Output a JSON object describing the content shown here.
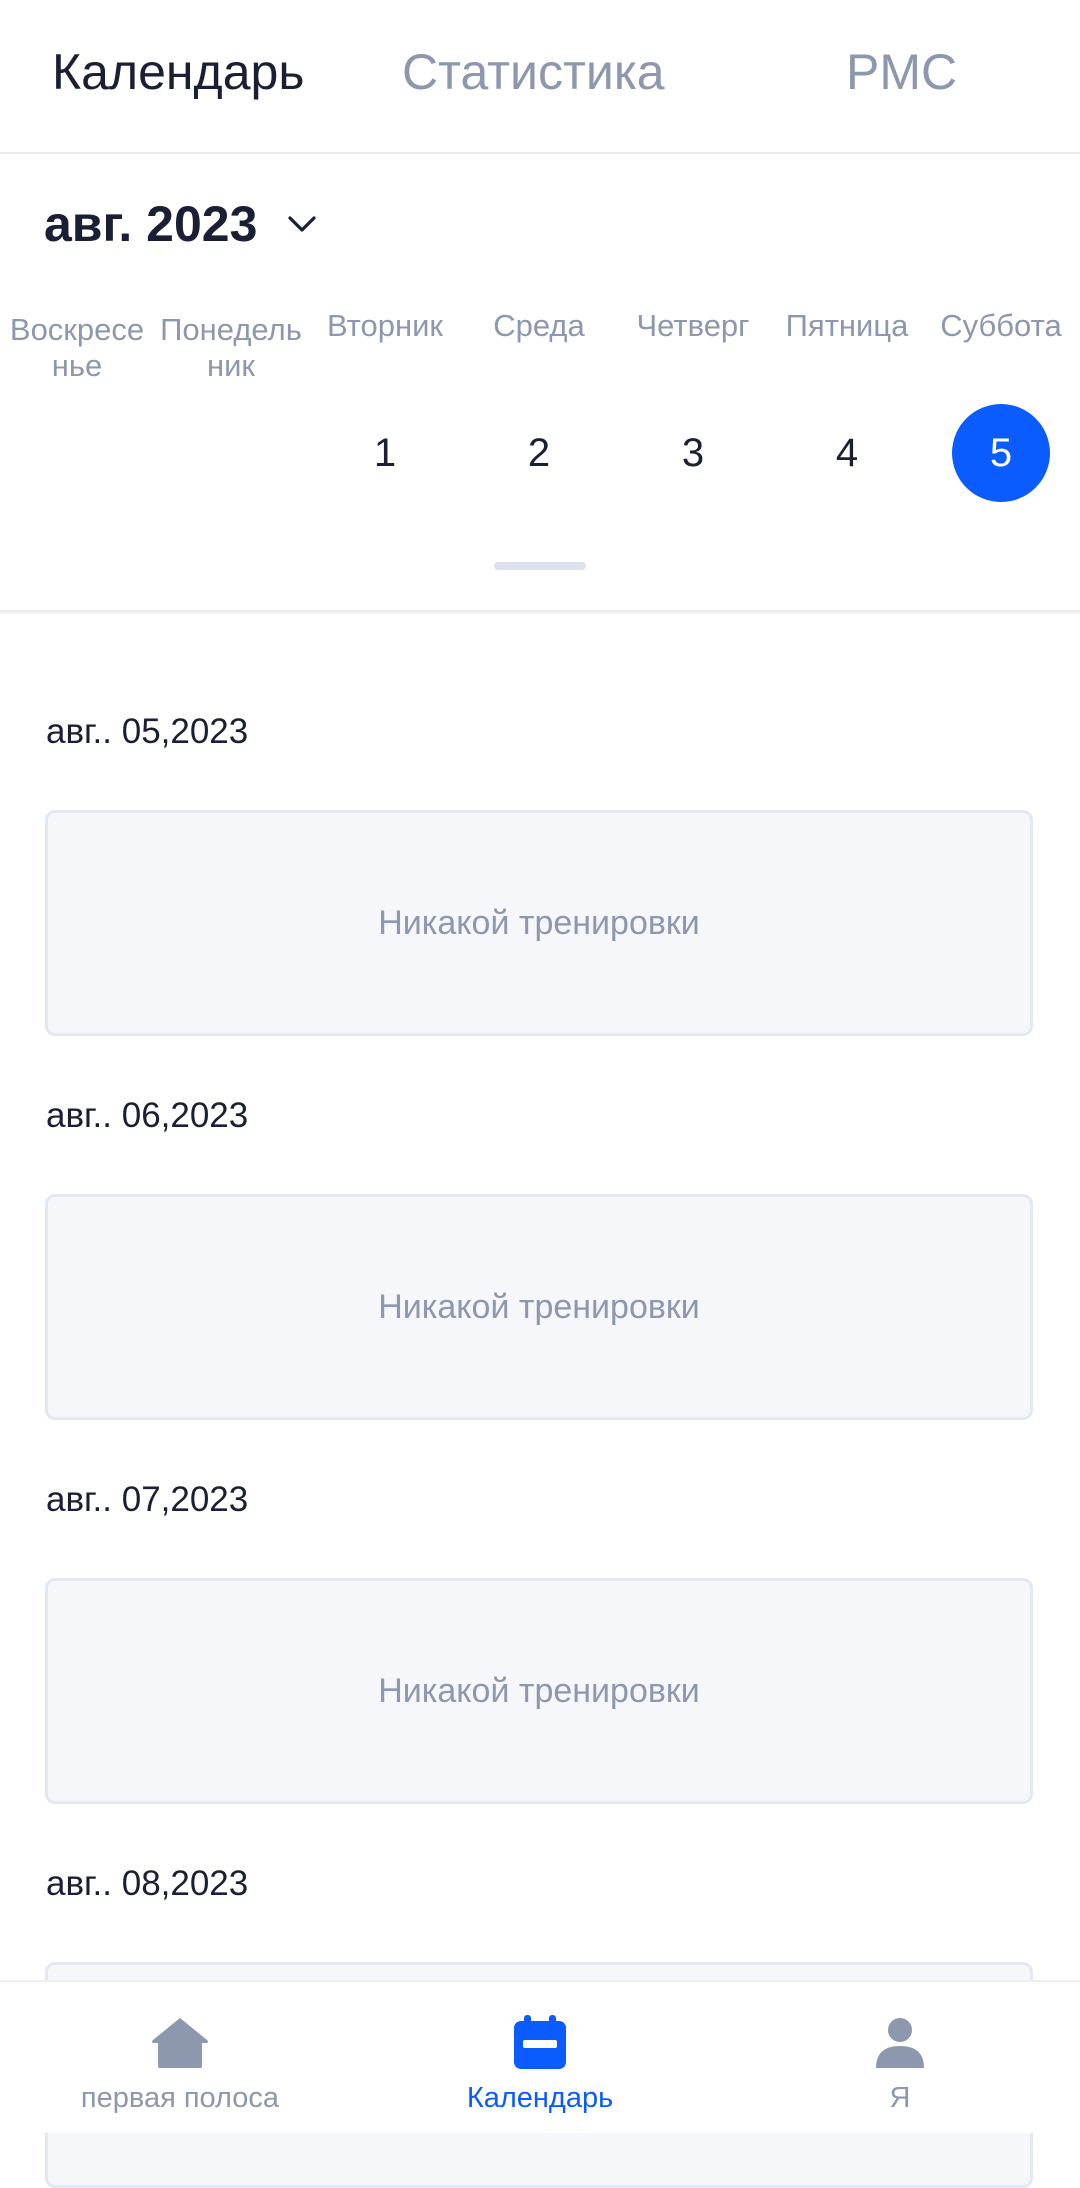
{
  "top_tabs": [
    {
      "label": "Календарь",
      "active": true
    },
    {
      "label": "Статистика",
      "active": false
    },
    {
      "label": "PMC",
      "active": false
    }
  ],
  "calendar": {
    "month_title": "авг. 2023",
    "weekdays": [
      "Воскресенье",
      "Понедельник",
      "Вторник",
      "Среда",
      "Четверг",
      "Пятница",
      "Суббота"
    ],
    "days": [
      "1",
      "2",
      "3",
      "4",
      "5"
    ],
    "selected_day": "5"
  },
  "schedule": [
    {
      "date": "авг.. 05,2023",
      "status": "Никакой тренировки"
    },
    {
      "date": "авг.. 06,2023",
      "status": "Никакой тренировки"
    },
    {
      "date": "авг.. 07,2023",
      "status": "Никакой тренировки"
    },
    {
      "date": "авг.. 08,2023",
      "status": ""
    }
  ],
  "bottom_nav": [
    {
      "label": "первая полоса",
      "icon": "home-icon"
    },
    {
      "label": "Календарь",
      "icon": "calendar-icon"
    },
    {
      "label": "Я",
      "icon": "person-icon"
    }
  ],
  "colors": {
    "accent": "#0a5cff",
    "text_primary": "#1a1f33",
    "text_secondary": "#8d97ad",
    "card_bg": "#f6f7fb"
  }
}
